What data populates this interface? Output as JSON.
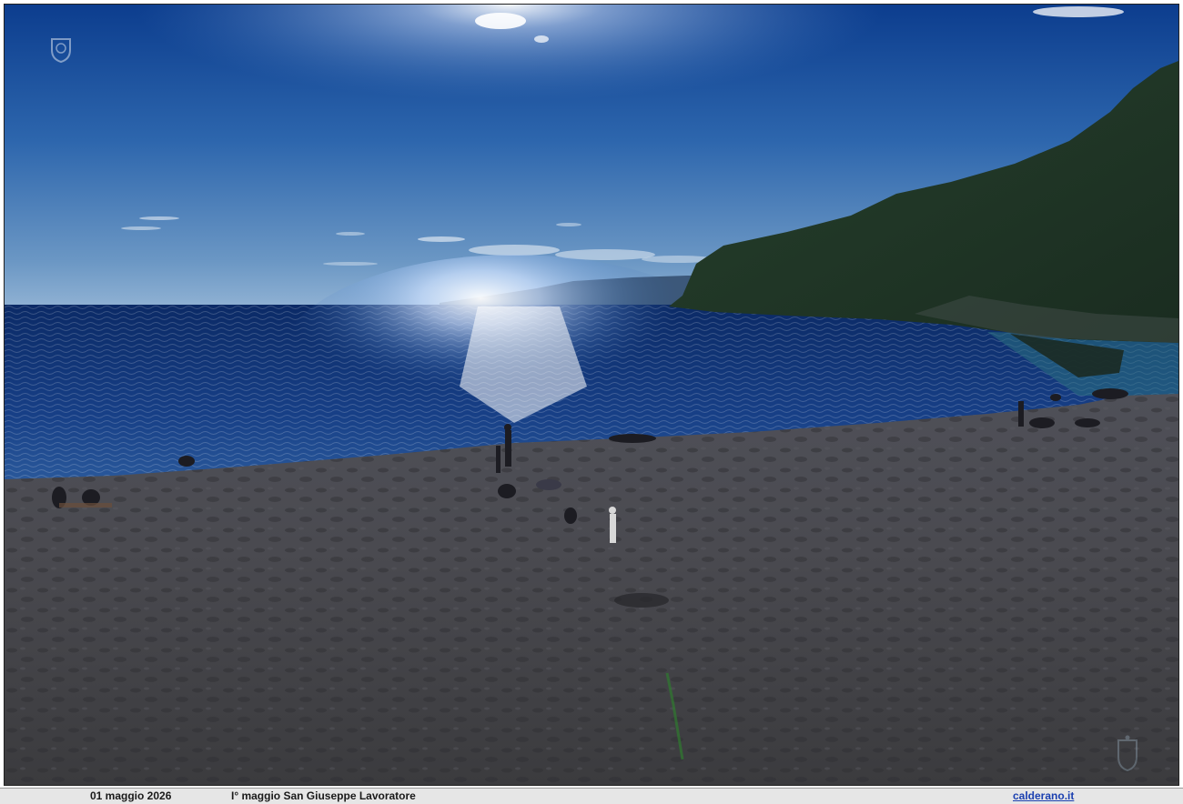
{
  "caption": {
    "date": "01 maggio 2026",
    "title": "I° maggio San Giuseppe Lavoratore",
    "site": "calderano.it"
  },
  "photo": {
    "subject": "beach-bay-backlit",
    "colors": {
      "sky_top": "#0d3f8f",
      "sky_horizon": "#7aa3cc",
      "sea_dark": "#0a2b6b",
      "sea_glint": "#eaf4ff",
      "sand": "#4b4b4f",
      "hill": "#1f3526"
    }
  },
  "icons": {
    "crest_top": "crest-watermark-icon",
    "crest_bottom": "crest-watermark-icon"
  }
}
